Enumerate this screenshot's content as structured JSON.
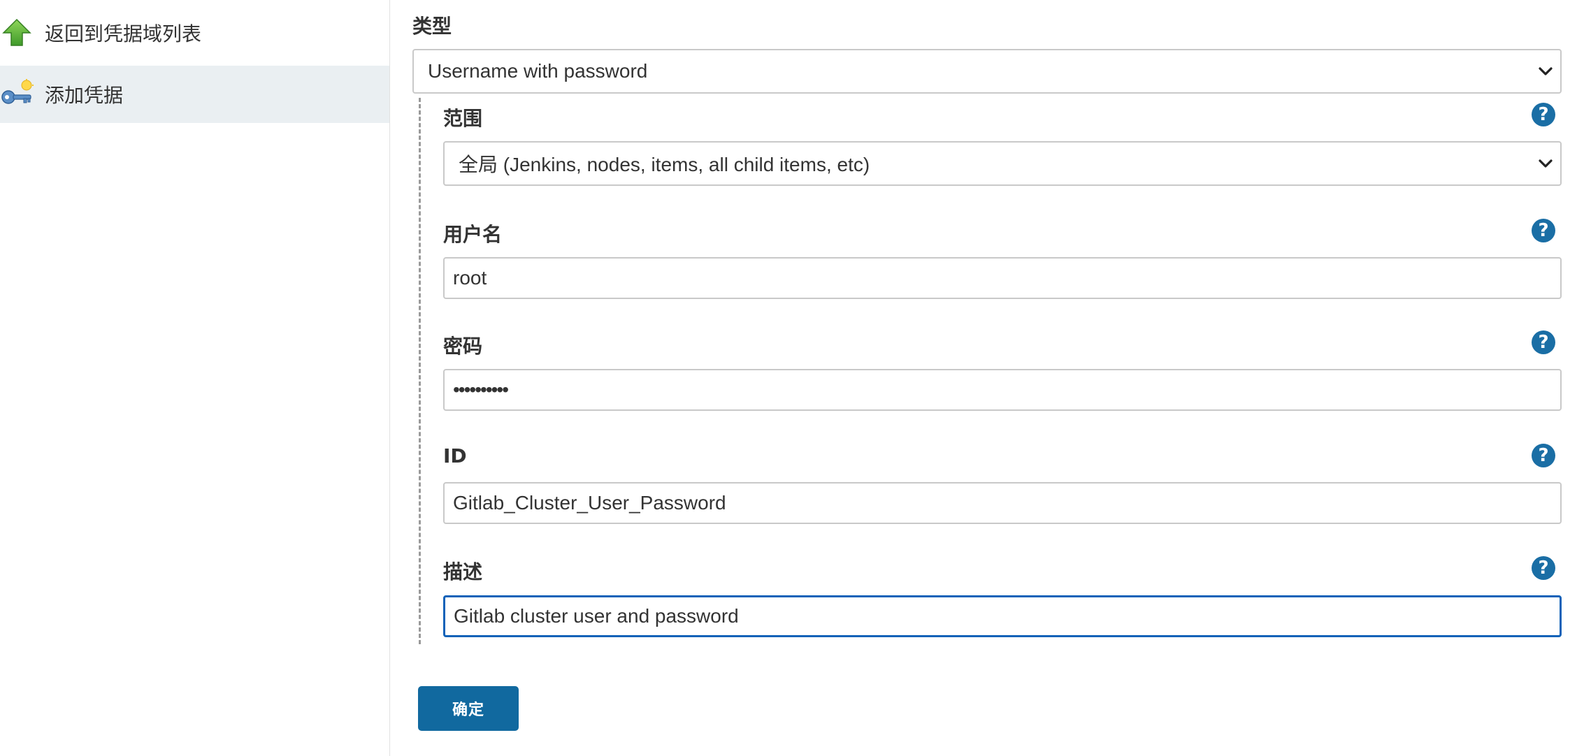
{
  "sidebar": {
    "items": [
      {
        "label": "返回到凭据域列表",
        "icon": "up-arrow-icon"
      },
      {
        "label": "添加凭据",
        "icon": "key-icon",
        "active": true
      }
    ]
  },
  "form": {
    "type_label": "类型",
    "type_value": "Username with password",
    "scope_label": "范围",
    "scope_value": "全局 (Jenkins, nodes, items, all child items, etc)",
    "username_label": "用户名",
    "username_value": "root",
    "password_label": "密码",
    "password_value": "••••••••••",
    "id_label": "ID",
    "id_value": "Gitlab_Cluster_User_Password",
    "description_label": "描述",
    "description_value": "Gitlab cluster user and password",
    "help_icon": "?",
    "submit_label": "确定"
  },
  "colors": {
    "accent": "#11699f",
    "help": "#1a6ea5",
    "focus": "#1062b8",
    "active_bg": "#eaeff2"
  }
}
